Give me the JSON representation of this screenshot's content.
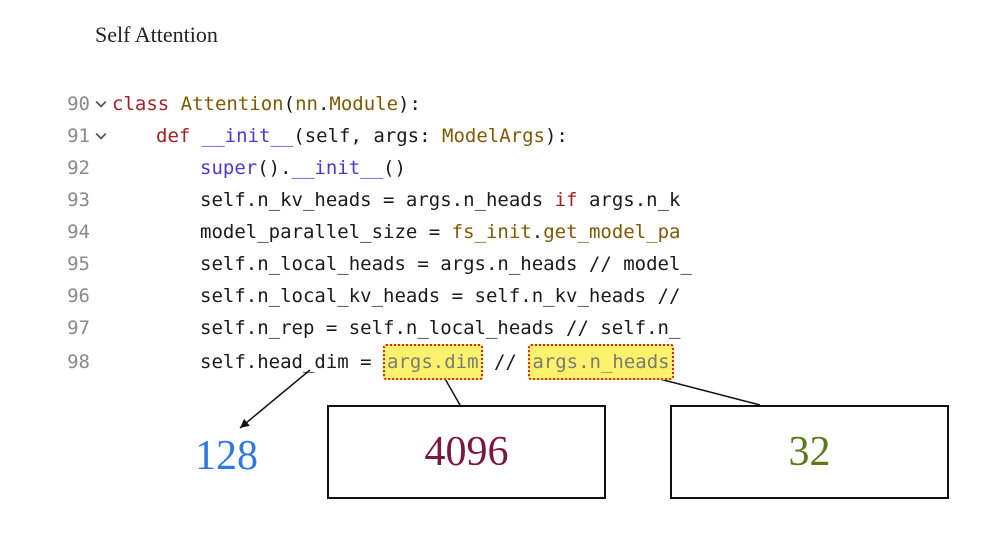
{
  "title": "Self Attention",
  "gutter": {
    "90": "90",
    "91": "91",
    "92": "92",
    "93": "93",
    "94": "94",
    "95": "95",
    "96": "96",
    "97": "97",
    "98": "98"
  },
  "code": {
    "l90": {
      "kw": "class",
      "name": "Attention",
      "paren_open": "(",
      "mod": "nn",
      "dot": ".",
      "sub": "Module",
      "paren_close": ")",
      "colon": ":"
    },
    "l91": {
      "kw": "def",
      "fn": "__init__",
      "args": "(self, args: ",
      "type": "ModelArgs",
      "close": "):"
    },
    "l92": {
      "fn": "super",
      "parens": "().",
      "init": "__init__",
      "tail": "()"
    },
    "l93": {
      "pre": "self.n_kv_heads = args.n_heads ",
      "kw": "if",
      "post": " args.n_k"
    },
    "l94": {
      "pre": "model_parallel_size = ",
      "mod": "fs_init",
      "dot": ".",
      "fn": "get_model_pa"
    },
    "l95": "self.n_local_heads = args.n_heads // model_",
    "l96": "self.n_local_kv_heads = self.n_kv_heads //",
    "l97": "self.n_rep = self.n_local_heads // self.n_",
    "l98": {
      "pre": "self.head_dim = ",
      "hl1": "args.dim",
      "mid": " // ",
      "hl2": "args.n_heads"
    }
  },
  "values": {
    "head_dim": "128",
    "dim": "4096",
    "n_heads": "32"
  }
}
